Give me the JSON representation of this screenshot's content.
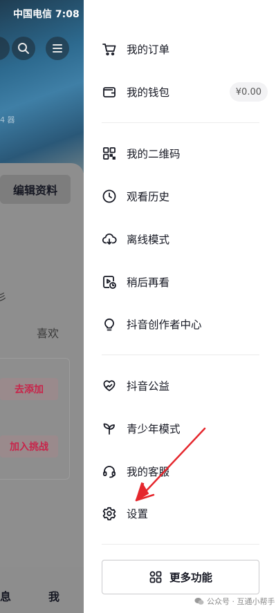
{
  "status_bar": {
    "carrier_time": "中国电信 7:08"
  },
  "background_page": {
    "faint_count": "4 器",
    "edit_profile": "编辑资料",
    "ghost_char": "彡",
    "like_tab": "喜欢",
    "add_button": "去添加",
    "join_button": "加入挑战",
    "nav_message": "息",
    "nav_me": "我"
  },
  "drawer": {
    "items": [
      {
        "label": "我的订单",
        "icon": "cart-icon"
      },
      {
        "label": "我的钱包",
        "icon": "wallet-icon",
        "badge": "¥0.00"
      },
      {
        "label": "我的二维码",
        "icon": "qr-code-icon"
      },
      {
        "label": "观看历史",
        "icon": "clock-icon"
      },
      {
        "label": "离线模式",
        "icon": "cloud-download-icon"
      },
      {
        "label": "稍后再看",
        "icon": "watch-later-icon"
      },
      {
        "label": "抖音创作者中心",
        "icon": "lightbulb-icon"
      },
      {
        "label": "抖音公益",
        "icon": "heart-hands-icon"
      },
      {
        "label": "青少年模式",
        "icon": "sprout-icon"
      },
      {
        "label": "我的客服",
        "icon": "headset-icon"
      },
      {
        "label": "设置",
        "icon": "gear-icon"
      }
    ],
    "more_button": "更多功能"
  },
  "watermark": "公众号 · 互通小帮手",
  "colors": {
    "annotation_arrow": "#e5272d",
    "overlay_gray": "#8f8f8f"
  }
}
